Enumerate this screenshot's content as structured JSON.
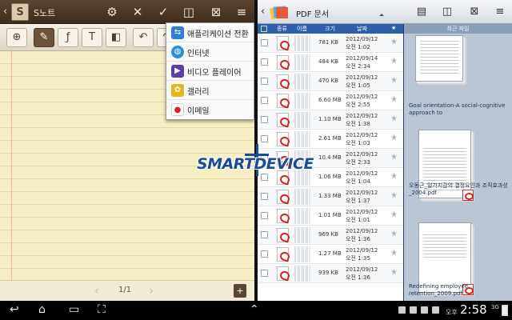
{
  "snote": {
    "title": "S노트",
    "app_icon_letter": "S",
    "page_indicator": "1/1"
  },
  "menu": {
    "items": [
      {
        "label": "애플리케이션 전환",
        "icon": "app-switch-icon",
        "color": "#2f7fd6"
      },
      {
        "label": "인터넷",
        "icon": "internet-globe-icon",
        "color": "#2f8ed6"
      },
      {
        "label": "비디오 플레이어",
        "icon": "video-player-icon",
        "color": "#5a3fa8"
      },
      {
        "label": "갤러리",
        "icon": "gallery-icon",
        "color": "#e5b51c"
      },
      {
        "label": "이메일",
        "icon": "email-icon",
        "color": "#d8231e"
      }
    ]
  },
  "filebrowser": {
    "title": "PDF 문서",
    "columns": {
      "type": "종류",
      "name": "이름",
      "size": "크기",
      "date": "날짜",
      "fav": "★"
    },
    "recent_header": "최근 파일",
    "rows": [
      {
        "size": "781 KB",
        "date": "2012/09/12",
        "time": "오전 1:02"
      },
      {
        "size": "484 KB",
        "date": "2012/09/14",
        "time": "오전 2:34"
      },
      {
        "size": "470 KB",
        "date": "2012/09/12",
        "time": "오전 1:05"
      },
      {
        "size": "6.60 MB",
        "date": "2012/09/12",
        "time": "오전 2:55"
      },
      {
        "size": "1.10 MB",
        "date": "2012/09/12",
        "time": "오전 1:38"
      },
      {
        "size": "2.61 MB",
        "date": "2012/09/12",
        "time": "오전 1:03"
      },
      {
        "size": "10.4 MB",
        "date": "2012/09/12",
        "time": "오전 2:33"
      },
      {
        "size": "1.06 MB",
        "date": "2012/09/12",
        "time": "오전 1:04"
      },
      {
        "size": "1.33 MB",
        "date": "2012/09/12",
        "time": "오전 1:37"
      },
      {
        "size": "1.01 MB",
        "date": "2012/09/12",
        "time": "오전 1:01"
      },
      {
        "size": "969 KB",
        "date": "2012/09/12",
        "time": "오전 1:36"
      },
      {
        "size": "1.27 MB",
        "date": "2012/09/12",
        "time": "오전 1:35"
      },
      {
        "size": "939 KB",
        "date": "2012/09/12",
        "time": "오전 1:36"
      }
    ],
    "recent": [
      {
        "caption": "Goal orientation-A social-cognitive approach to"
      },
      {
        "caption": "오동근_일가치감의 결정요인과 조직효과성_2004.pdf"
      },
      {
        "caption": "Redefining employee retention_2009.pdf"
      }
    ]
  },
  "watermark": {
    "text": "SMARTDEVICE"
  },
  "statusbar": {
    "ampm": "오후",
    "time": "2:58",
    "network": "3G"
  }
}
